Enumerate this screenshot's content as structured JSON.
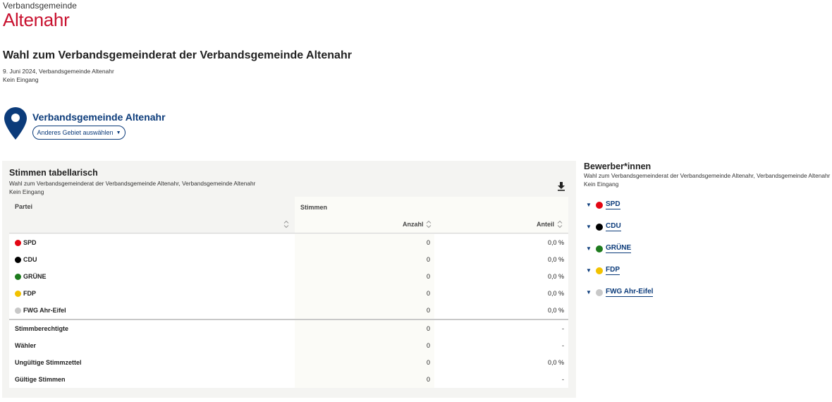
{
  "logo": {
    "line1": "Verbandsgemeinde",
    "line2": "Altenahr"
  },
  "title": "Wahl zum Verbandsgemeinderat der Verbandsgemeinde Altenahr",
  "date_line": "9. Juni 2024, Verbandsgemeinde Altenahr",
  "status": "Kein Eingang",
  "location": {
    "name": "Verbandsgemeinde Altenahr",
    "button": "Anderes Gebiet auswählen",
    "button_icon": "▼"
  },
  "table_panel": {
    "title": "Stimmen tabellarisch",
    "subtitle": "Wahl zum Verbandsgemeinderat der Verbandsgemeinde Altenahr, Verbandsgemeinde Altenahr",
    "status": "Kein Eingang",
    "headers": {
      "party": "Partei",
      "votes": "Stimmen",
      "count": "Anzahl",
      "share": "Anteil"
    },
    "parties": [
      {
        "name": "SPD",
        "color": "#e30613",
        "count": "0",
        "share": "0,0 %"
      },
      {
        "name": "CDU",
        "color": "#000000",
        "count": "0",
        "share": "0,0 %"
      },
      {
        "name": "GRÜNE",
        "color": "#1e7b1e",
        "count": "0",
        "share": "0,0 %"
      },
      {
        "name": "FDP",
        "color": "#f2c200",
        "count": "0",
        "share": "0,0 %"
      },
      {
        "name": "FWG Ahr-Eifel",
        "color": "#c8c8c8",
        "count": "0",
        "share": "0,0 %"
      }
    ],
    "summary": [
      {
        "name": "Stimmberechtigte",
        "count": "0",
        "share": "-"
      },
      {
        "name": "Wähler",
        "count": "0",
        "share": "-"
      },
      {
        "name": "Ungültige Stimmzettel",
        "count": "0",
        "share": "0,0 %"
      },
      {
        "name": "Gültige Stimmen",
        "count": "0",
        "share": "-"
      }
    ]
  },
  "candidates_panel": {
    "title": "Bewerber*innen",
    "subtitle": "Wahl zum Verbandsgemeinderat der Verbandsgemeinde Altenahr, Verbandsgemeinde Altenahr",
    "status": "Kein Eingang",
    "toggle_icon": "▼",
    "parties": [
      {
        "name": "SPD",
        "color": "#e30613"
      },
      {
        "name": "CDU",
        "color": "#000000"
      },
      {
        "name": "GRÜNE",
        "color": "#1e7b1e"
      },
      {
        "name": "FDP",
        "color": "#f2c200"
      },
      {
        "name": "FWG Ahr-Eifel",
        "color": "#c8c8c8"
      }
    ]
  },
  "icons": {
    "location": "map-pin-icon",
    "download": "download-icon",
    "sort": "sort-icon"
  },
  "colors": {
    "brand_red": "#c8102e",
    "link_blue": "#0b3b7a"
  }
}
